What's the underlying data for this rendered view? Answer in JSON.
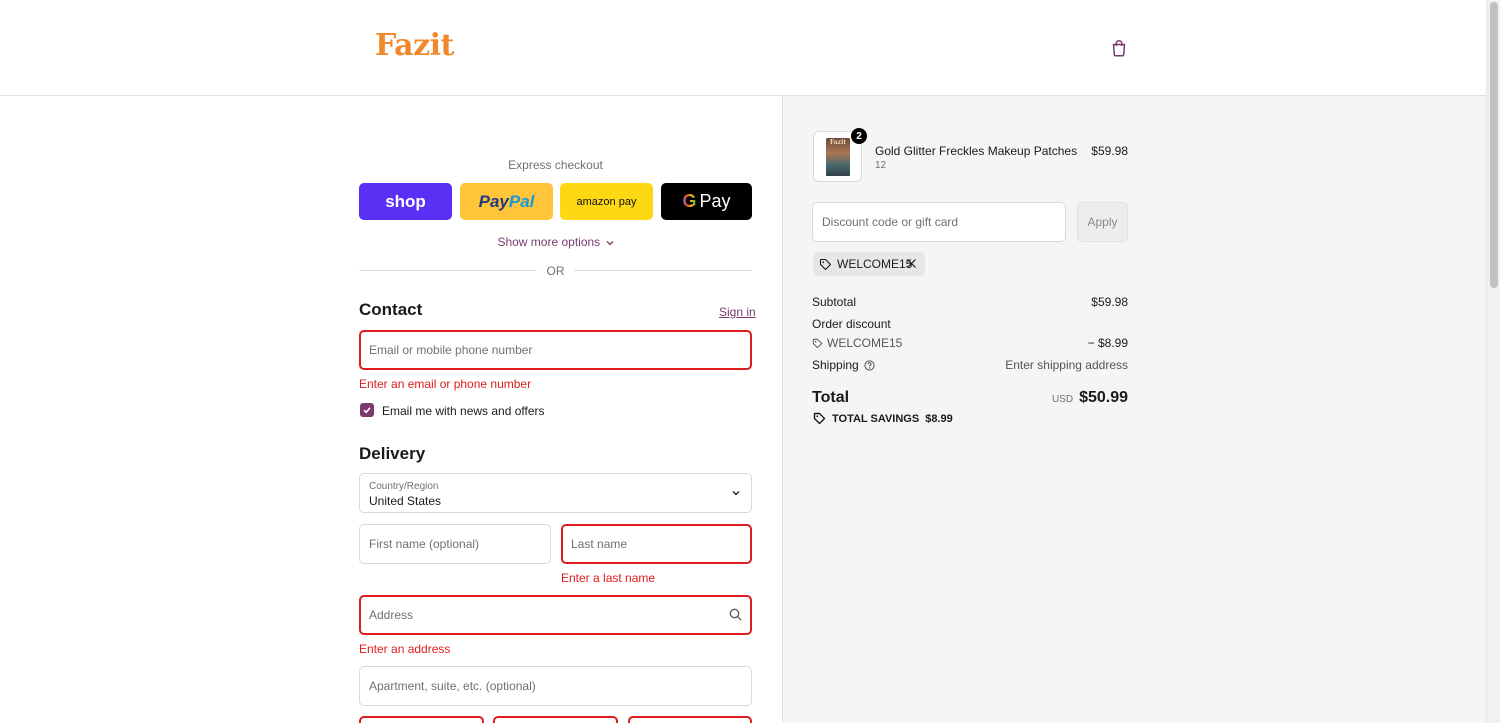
{
  "header": {
    "logo": "Fazit",
    "cart_icon": "shopping-bag-icon"
  },
  "express": {
    "label": "Express checkout",
    "shop_label": "shop",
    "paypal_pay": "Pay",
    "paypal_pal": "Pal",
    "amazon_label": "amazon pay",
    "gpay_g": "G",
    "gpay_label": "Pay",
    "show_more": "Show more options",
    "or": "OR"
  },
  "contact": {
    "title": "Contact",
    "sign_in": "Sign in",
    "email_placeholder": "Email or mobile phone number",
    "email_error": "Enter an email or phone number",
    "newsletter_label": "Email me with news and offers",
    "newsletter_checked": true
  },
  "delivery": {
    "title": "Delivery",
    "country_label": "Country/Region",
    "country_value": "United States",
    "first_name_placeholder": "First name (optional)",
    "last_name_placeholder": "Last name",
    "last_name_error": "Enter a last name",
    "address_placeholder": "Address",
    "address_error": "Enter an address",
    "apartment_placeholder": "Apartment, suite, etc. (optional)"
  },
  "summary": {
    "product": {
      "name": "Gold Glitter Freckles Makeup Patches",
      "variant": "12",
      "price": "$59.98",
      "quantity": "2",
      "thumb_logo": "Fazit"
    },
    "discount_placeholder": "Discount code or gift card",
    "apply_label": "Apply",
    "applied_code": "WELCOME15",
    "subtotal_label": "Subtotal",
    "subtotal_value": "$59.98",
    "order_discount_label": "Order discount",
    "discount_code": "WELCOME15",
    "discount_value": "− $8.99",
    "shipping_label": "Shipping",
    "shipping_value": "Enter shipping address",
    "total_label": "Total",
    "total_currency": "USD",
    "total_value": "$50.99",
    "savings_label": "TOTAL SAVINGS",
    "savings_value": "$8.99"
  },
  "colors": {
    "brand": "#ee8a2d",
    "accent": "#7a3a6e",
    "error": "#dd1d1d",
    "shop_pay": "#5a31f4",
    "paypal": "#ffc439",
    "amazon_pay": "#ffd814"
  }
}
